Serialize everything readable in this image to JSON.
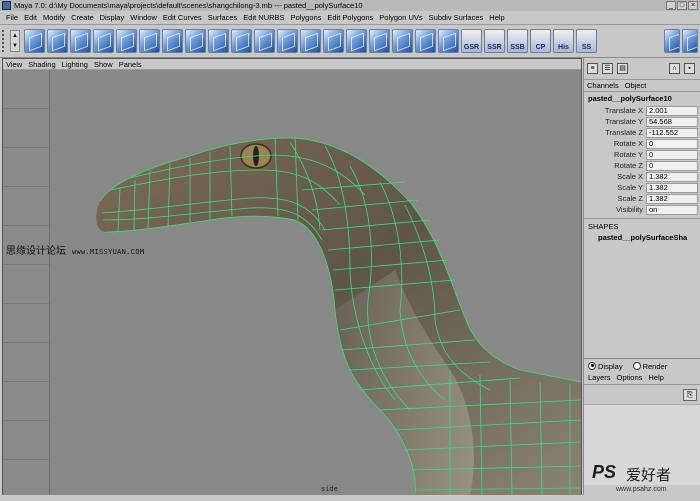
{
  "window": {
    "title": "Maya 7.0: d:\\My Documents\\maya\\projects\\default\\scenes\\shangchilong-3.mb   ---   pasted__polySurface10"
  },
  "menubar": [
    "File",
    "Edit",
    "Modify",
    "Create",
    "Display",
    "Window",
    "Edit Curves",
    "Surfaces",
    "Edit NURBS",
    "Polygons",
    "Edit Polygons",
    "Polygon UVs",
    "Subdiv Surfaces",
    "Help"
  ],
  "shelf": {
    "text_tools": [
      "GSR",
      "SSR",
      "SSB",
      "CP",
      "His",
      "SS"
    ]
  },
  "viewport": {
    "menu": [
      "View",
      "Shading",
      "Lighting",
      "Show",
      "Panels"
    ],
    "camera_label": "side"
  },
  "channel_box": {
    "tabs": [
      "Channels",
      "Object"
    ],
    "object_name": "pasted__polySurface10",
    "attributes": [
      {
        "name": "Translate X",
        "value": "2.001"
      },
      {
        "name": "Translate Y",
        "value": "54.568"
      },
      {
        "name": "Translate Z",
        "value": "-112.552"
      },
      {
        "name": "Rotate X",
        "value": "0"
      },
      {
        "name": "Rotate Y",
        "value": "0"
      },
      {
        "name": "Rotate Z",
        "value": "0"
      },
      {
        "name": "Scale X",
        "value": "1.382"
      },
      {
        "name": "Scale Y",
        "value": "1.382"
      },
      {
        "name": "Scale Z",
        "value": "1.382"
      },
      {
        "name": "Visibility",
        "value": "on"
      }
    ],
    "shapes_header": "SHAPES",
    "shape_name": "pasted__polySurfaceSha"
  },
  "layer_editor": {
    "display_label": "Display",
    "render_label": "Render",
    "menu": [
      "Layers",
      "Options",
      "Help"
    ]
  },
  "watermark": {
    "text": "思缘设计论坛",
    "url": "www.MISSYUAN.COM"
  },
  "logo": {
    "big": "PS",
    "zh": "爱好者",
    "url": "www.psahz.com"
  },
  "colors": {
    "wireframe": "#37e07a",
    "viewport_bg": "#888888",
    "ui_gray": "#c8c8c8"
  }
}
